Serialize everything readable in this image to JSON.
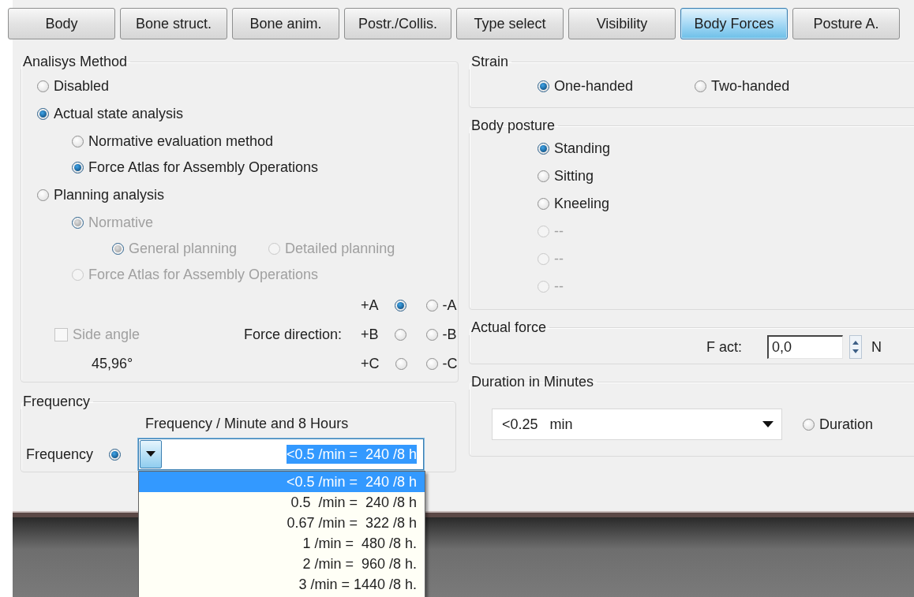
{
  "tabs": [
    {
      "label": "Body",
      "selected": false
    },
    {
      "label": "Bone struct.",
      "selected": false
    },
    {
      "label": "Bone anim.",
      "selected": false
    },
    {
      "label": "Postr./Collis.",
      "selected": false
    },
    {
      "label": "Type select",
      "selected": false
    },
    {
      "label": "Visibility",
      "selected": false
    },
    {
      "label": "Body Forces",
      "selected": true
    },
    {
      "label": "Posture A.",
      "selected": false
    }
  ],
  "analysis_method": {
    "title": "Analisys Method",
    "options": [
      {
        "label": "Disabled",
        "selected": false,
        "disabled": false
      },
      {
        "label": "Actual state analysis",
        "selected": true,
        "disabled": false,
        "children": [
          {
            "label": "Normative evaluation method",
            "selected": false,
            "disabled": false
          },
          {
            "label": "Force Atlas for Assembly Operations",
            "selected": true,
            "disabled": false
          }
        ]
      },
      {
        "label": "Planning analysis",
        "selected": false,
        "disabled": false,
        "children": [
          {
            "label": "Normative",
            "selected": true,
            "disabled": true,
            "children": [
              {
                "label": "General planning",
                "selected": true,
                "disabled": true
              },
              {
                "label": "Detailed planning",
                "selected": false,
                "disabled": true
              }
            ]
          },
          {
            "label": "Force Atlas for Assembly Operations",
            "selected": false,
            "disabled": true
          }
        ]
      }
    ],
    "side_angle": {
      "label": "Side angle",
      "checked": false,
      "disabled": true,
      "value": "45,96°"
    },
    "force_direction": {
      "label": "Force direction:",
      "options": [
        {
          "label": "+A",
          "selected": true
        },
        {
          "label": "-A",
          "selected": false
        },
        {
          "label": "+B",
          "selected": false
        },
        {
          "label": "-B",
          "selected": false
        },
        {
          "label": "+C",
          "selected": false
        },
        {
          "label": "-C",
          "selected": false
        }
      ]
    }
  },
  "frequency": {
    "title": "Frequency",
    "caption": "Frequency / Minute and 8 Hours",
    "radio": {
      "label": "Frequency",
      "selected": true
    },
    "combo": {
      "value": "<0.5 /min =  240 /8 h",
      "expanded": true,
      "options": [
        {
          "label": "<0.5 /min =  240 /8 h",
          "selected": true
        },
        {
          "label": "0.5  /min =  240 /8 h",
          "selected": false
        },
        {
          "label": "0.67 /min =  322 /8 h",
          "selected": false
        },
        {
          "label": "1 /min =  480 /8 h.",
          "selected": false
        },
        {
          "label": "2 /min =  960 /8 h.",
          "selected": false
        },
        {
          "label": "3 /min = 1440 /8 h.",
          "selected": false
        }
      ]
    }
  },
  "strain": {
    "title": "Strain",
    "options": [
      {
        "label": "One-handed",
        "selected": true
      },
      {
        "label": "Two-handed",
        "selected": false
      }
    ]
  },
  "body_posture": {
    "title": "Body posture",
    "options": [
      {
        "label": "Standing",
        "selected": true,
        "disabled": false
      },
      {
        "label": "Sitting",
        "selected": false,
        "disabled": false
      },
      {
        "label": "Kneeling",
        "selected": false,
        "disabled": false
      },
      {
        "label": "--",
        "selected": false,
        "disabled": true
      },
      {
        "label": "--",
        "selected": false,
        "disabled": true
      },
      {
        "label": "--",
        "selected": false,
        "disabled": true
      }
    ]
  },
  "actual_force": {
    "title": "Actual force",
    "label": "F act:",
    "value": "0,0",
    "unit": "N"
  },
  "duration": {
    "title": "Duration in Minutes",
    "combo": {
      "value": "<0.25   min"
    },
    "radio": {
      "label": "Duration",
      "selected": false
    }
  }
}
